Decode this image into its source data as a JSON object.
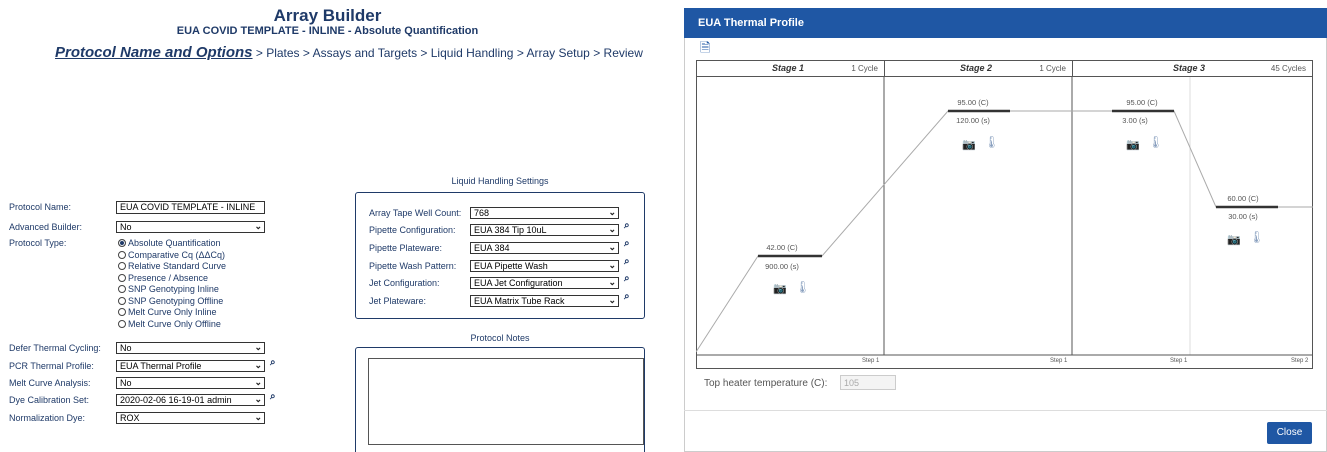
{
  "header": {
    "title": "Array Builder",
    "subtitle": "EUA COVID TEMPLATE - INLINE - Absolute Quantification"
  },
  "breadcrumb": {
    "active": "Protocol Name and Options",
    "rest": " > Plates > Assays and Targets > Liquid Handling > Array Setup > Review"
  },
  "form": {
    "protocol_name_label": "Protocol Name:",
    "protocol_name_value": "EUA COVID TEMPLATE - INLINE",
    "advanced_builder_label": "Advanced Builder:",
    "advanced_builder_value": "No",
    "protocol_type_label": "Protocol Type:",
    "protocol_types": [
      {
        "label": "Absolute Quantification",
        "selected": true
      },
      {
        "label": "Comparative Cq (ΔΔCq)",
        "selected": false
      },
      {
        "label": "Relative Standard Curve",
        "selected": false
      },
      {
        "label": "Presence / Absence",
        "selected": false
      },
      {
        "label": "SNP Genotyping Inline",
        "selected": false
      },
      {
        "label": "SNP Genotyping Offline",
        "selected": false
      },
      {
        "label": "Melt Curve Only Inline",
        "selected": false
      },
      {
        "label": "Melt Curve Only Offline",
        "selected": false
      }
    ],
    "defer_label": "Defer Thermal Cycling:",
    "defer_value": "No",
    "pcr_profile_label": "PCR Thermal Profile:",
    "pcr_profile_value": "EUA Thermal Profile",
    "melt_label": "Melt Curve Analysis:",
    "melt_value": "No",
    "dye_cal_label": "Dye Calibration Set:",
    "dye_cal_value": "2020-02-06 16-19-01 admin",
    "norm_dye_label": "Normalization Dye:",
    "norm_dye_value": "ROX"
  },
  "liquid": {
    "title": "Liquid Handling Settings",
    "tape_label": "Array Tape Well Count:",
    "tape_value": "768",
    "pipette_config_label": "Pipette Configuration:",
    "pipette_config_value": "EUA 384 Tip 10uL",
    "pipette_plate_label": "Pipette Plateware:",
    "pipette_plate_value": "EUA 384",
    "wash_label": "Pipette Wash Pattern:",
    "wash_value": "EUA Pipette Wash",
    "jet_config_label": "Jet Configuration:",
    "jet_config_value": "EUA Jet Configuration",
    "jet_plate_label": "Jet Plateware:",
    "jet_plate_value": "EUA Matrix Tube Rack"
  },
  "notes": {
    "title": "Protocol Notes"
  },
  "dialog": {
    "title": "EUA Thermal Profile",
    "stages": [
      {
        "name": "Stage 1",
        "cycles": "1 Cycle"
      },
      {
        "name": "Stage 2",
        "cycles": "1 Cycle"
      },
      {
        "name": "Stage 3",
        "cycles": "45 Cycles"
      }
    ],
    "steps": [
      {
        "temp": "42.00 (C)",
        "time": "900.00 (s)",
        "label": "Step 1"
      },
      {
        "temp": "95.00 (C)",
        "time": "120.00 (s)",
        "label": "Step 1"
      },
      {
        "temp": "95.00 (C)",
        "time": "3.00 (s)",
        "label": "Step 1"
      },
      {
        "temp": "60.00 (C)",
        "time": "30.00 (s)",
        "label": "Step 2"
      }
    ],
    "top_heater_label": "Top heater temperature (C):",
    "top_heater_value": "105",
    "close_label": "Close"
  },
  "icons": {
    "binoculars": "⌕",
    "camera": "📷",
    "thermometer": "🌡",
    "document": "🗎"
  }
}
